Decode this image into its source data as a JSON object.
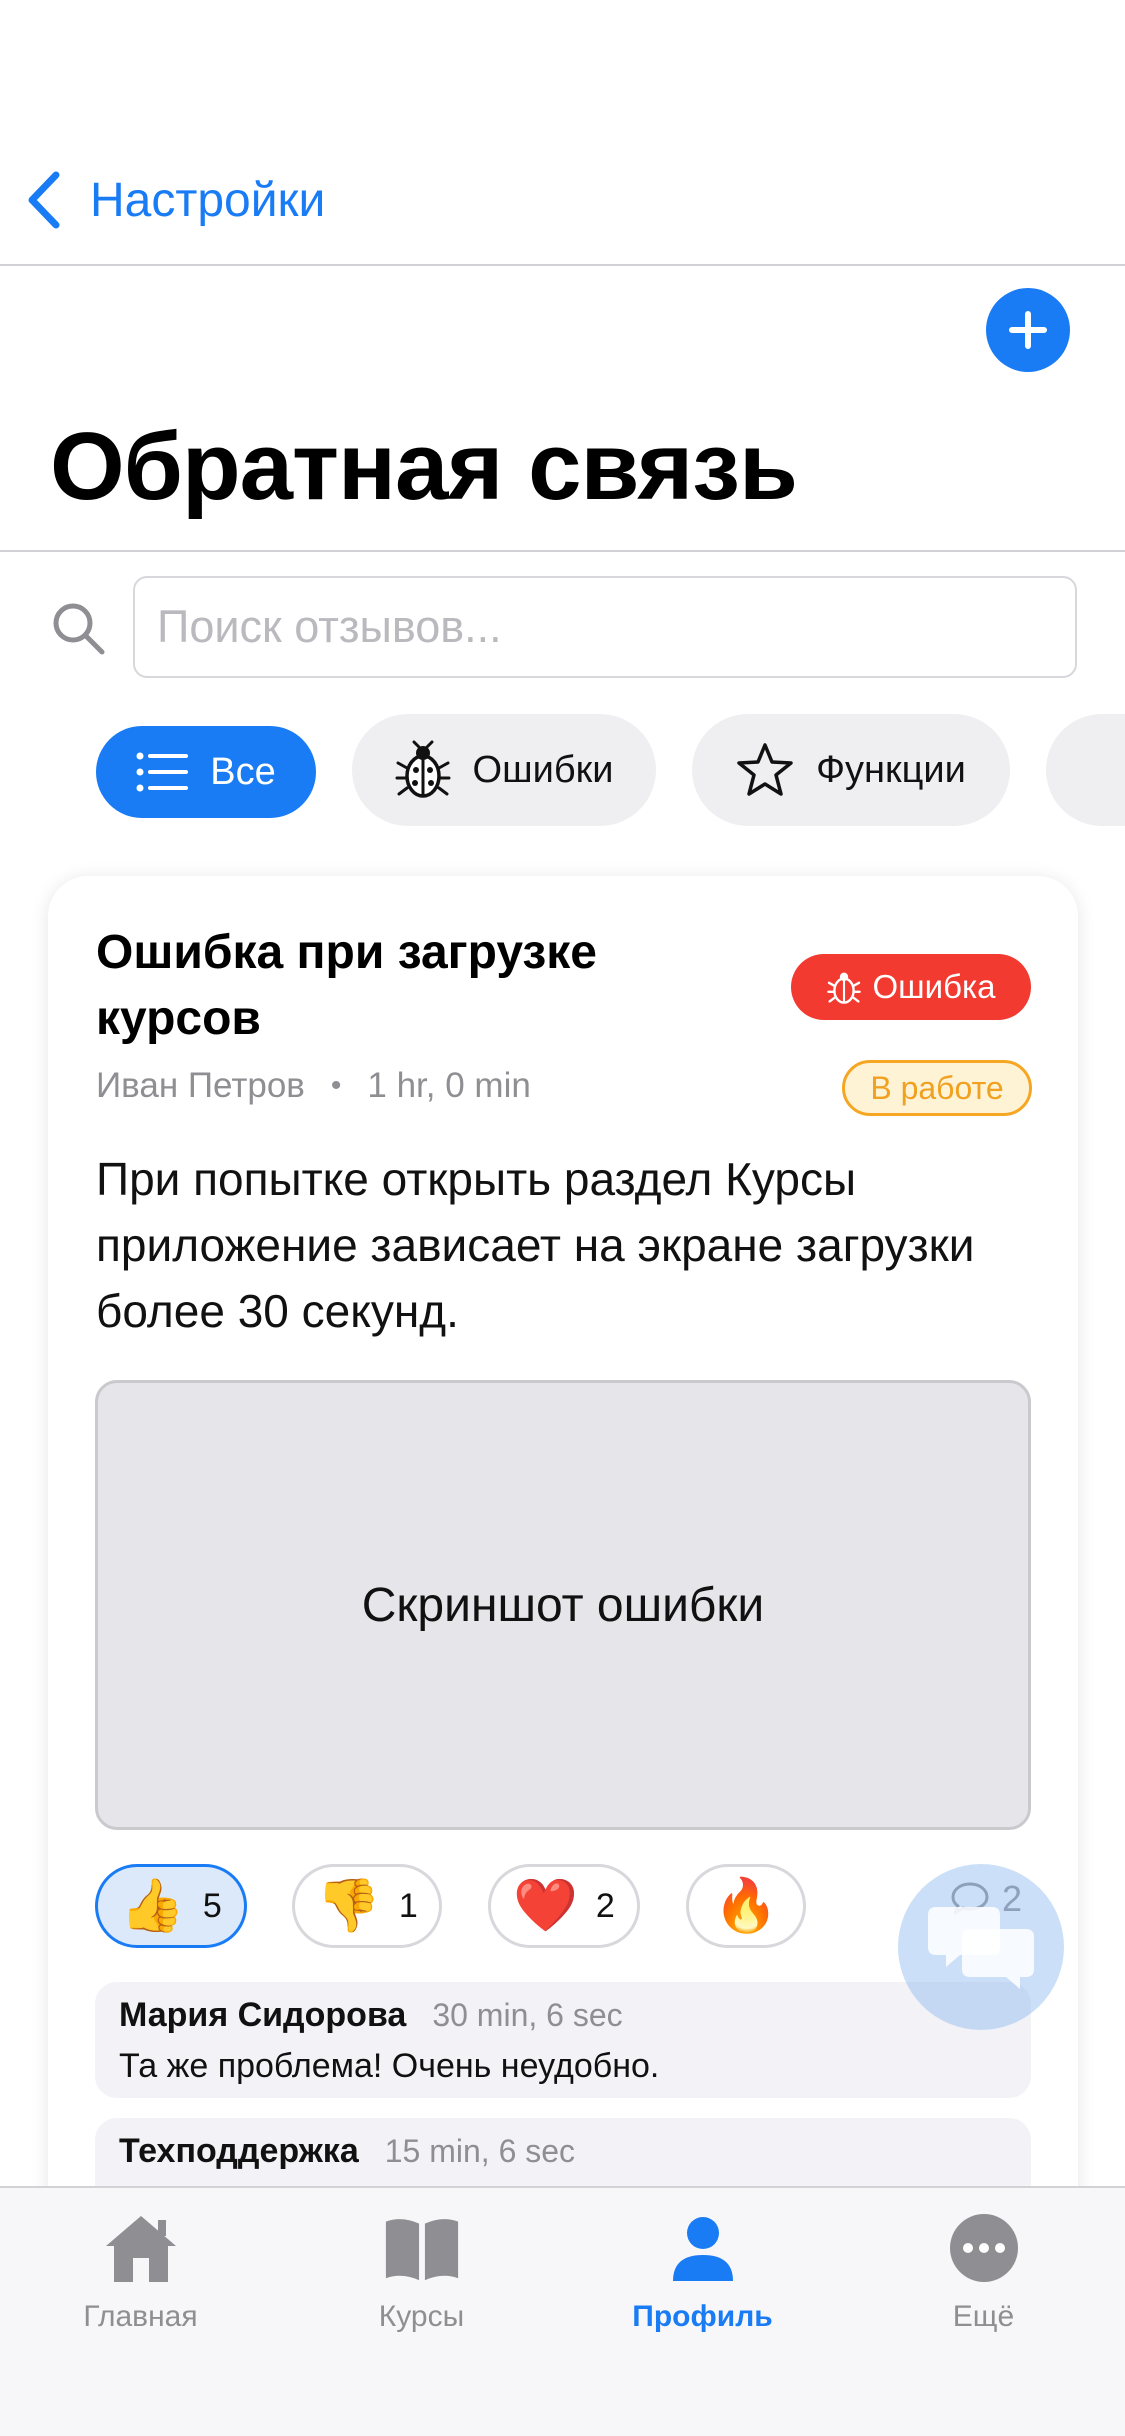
{
  "nav": {
    "back_label": "Настройки"
  },
  "page": {
    "title": "Обратная связь"
  },
  "search": {
    "placeholder": "Поиск отзывов..."
  },
  "filters": [
    {
      "label": "Все",
      "icon": "list-icon",
      "active": true
    },
    {
      "label": "Ошибки",
      "icon": "bug-icon",
      "active": false
    },
    {
      "label": "Функции",
      "icon": "star-icon",
      "active": false
    }
  ],
  "post": {
    "title": "Ошибка при загрузке курсов",
    "type_badge": "Ошибка",
    "author": "Иван Петров",
    "time": "1 hr, 0 min",
    "status": "В работе",
    "body": "При попытке открыть раздел Курсы приложение зависает на экране загрузки более 30 секунд.",
    "screenshot_label": "Скриншот ошибки",
    "reactions": [
      {
        "emoji": "👍",
        "count": "5",
        "selected": true
      },
      {
        "emoji": "👎",
        "count": "1",
        "selected": false
      },
      {
        "emoji": "❤️",
        "count": "2",
        "selected": false
      },
      {
        "emoji": "🔥",
        "count": "",
        "selected": false
      }
    ],
    "comment_count": "2",
    "comments": [
      {
        "author": "Мария Сидорова",
        "time": "30 min, 6 sec",
        "text": "Та же проблема! Очень неудобно."
      },
      {
        "author": "Техподдержка",
        "time": "15 min, 6 sec",
        "text": ""
      }
    ]
  },
  "tabs": [
    {
      "label": "Главная",
      "icon": "home-icon",
      "active": false
    },
    {
      "label": "Курсы",
      "icon": "book-icon",
      "active": false
    },
    {
      "label": "Профиль",
      "icon": "person-icon",
      "active": true
    },
    {
      "label": "Ещё",
      "icon": "more-icon",
      "active": false
    }
  ],
  "colors": {
    "accent": "#1a7cf5",
    "bug_badge": "#f23a30",
    "status": "#f0a11f"
  }
}
